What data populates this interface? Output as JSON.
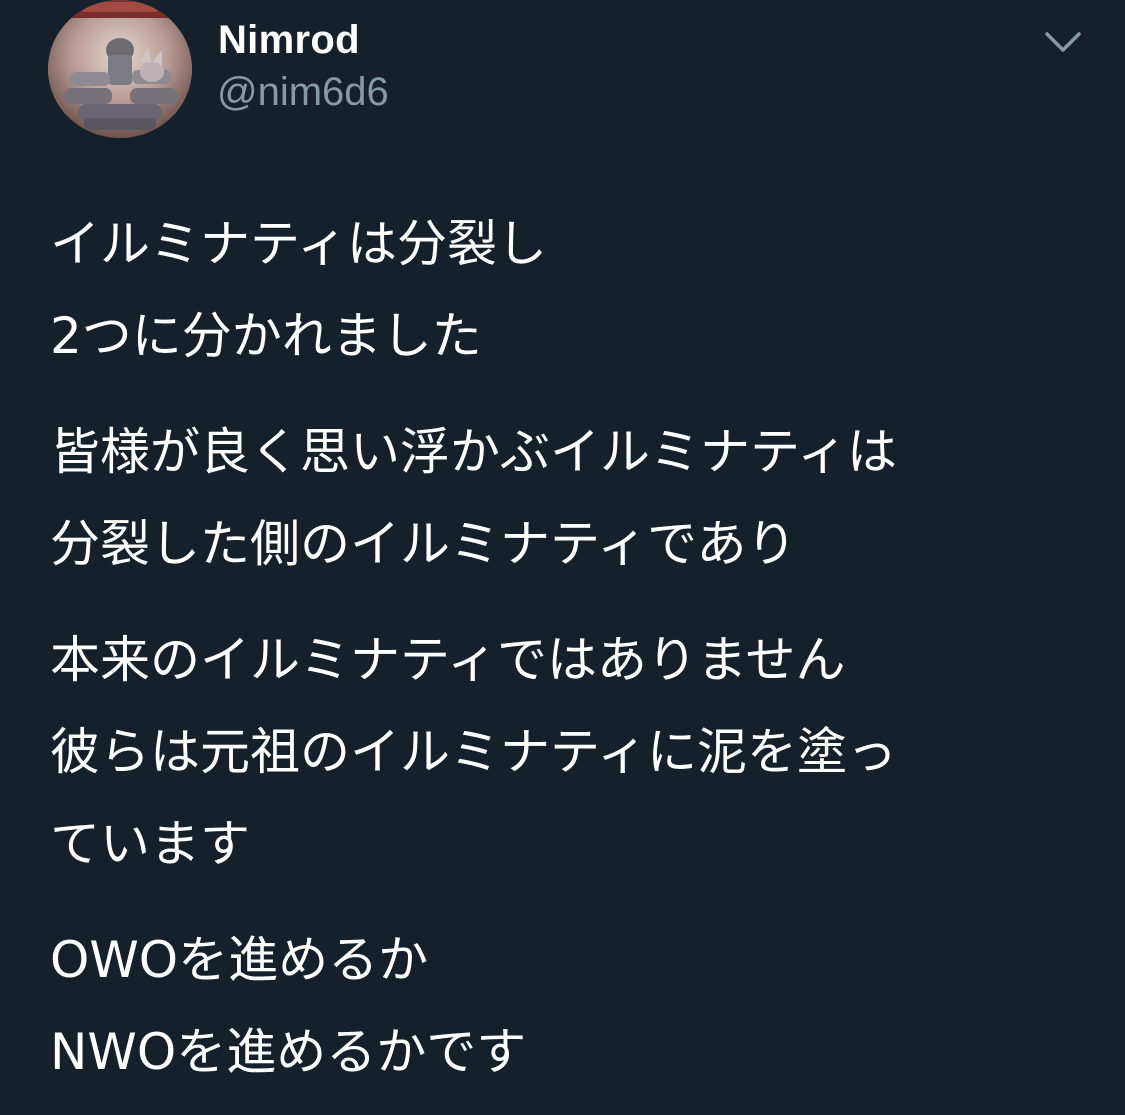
{
  "tweet": {
    "author": {
      "display_name": "Nimrod",
      "handle": "@nim6d6",
      "avatar_icon": "avatar-image"
    },
    "menu_icon": "chevron-down-icon",
    "paragraphs": [
      [
        "イルミナティは分裂し",
        "2つに分かれました"
      ],
      [
        "皆様が良く思い浮かぶイルミナティは",
        "分裂した側のイルミナティであり"
      ],
      [
        "本来のイルミナティではありません",
        "彼らは元祖のイルミナティに泥を塗っ",
        "ています"
      ],
      [
        "OWOを進めるか",
        "NWOを進めるかです"
      ]
    ]
  },
  "colors": {
    "background": "#15202b",
    "text": "#ffffff",
    "secondary": "#8899a6"
  }
}
